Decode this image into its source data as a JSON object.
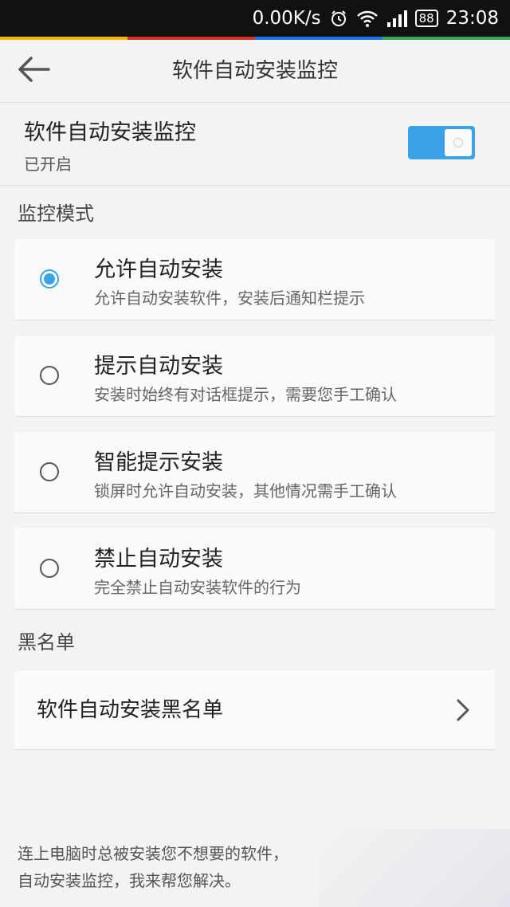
{
  "status_bar": {
    "speed": "0.00K/s",
    "battery": "88",
    "time": "23:08"
  },
  "colors": {
    "accent": "#3aa3e8",
    "strip": [
      "#f5b400",
      "#d93025",
      "#1a73e8",
      "#34a853"
    ]
  },
  "app_bar": {
    "back_icon": "arrow-left-icon",
    "title": "软件自动安装监控"
  },
  "master": {
    "title": "软件自动安装监控",
    "status": "已开启",
    "enabled": true
  },
  "monitor_section": {
    "header": "监控模式",
    "options": [
      {
        "title": "允许自动安装",
        "desc": "允许自动安装软件，安装后通知栏提示",
        "selected": true
      },
      {
        "title": "提示自动安装",
        "desc": "安装时始终有对话框提示，需要您手工确认",
        "selected": false
      },
      {
        "title": "智能提示安装",
        "desc": "锁屏时允许自动安装，其他情况需手工确认",
        "selected": false
      },
      {
        "title": "禁止自动安装",
        "desc": "完全禁止自动安装软件的行为",
        "selected": false
      }
    ]
  },
  "blacklist_section": {
    "header": "黑名单",
    "item_label": "软件自动安装黑名单"
  },
  "footer": {
    "line1": "连上电脑时总被安装您不想要的软件，",
    "line2": "自动安装监控，我来帮您解决。"
  }
}
